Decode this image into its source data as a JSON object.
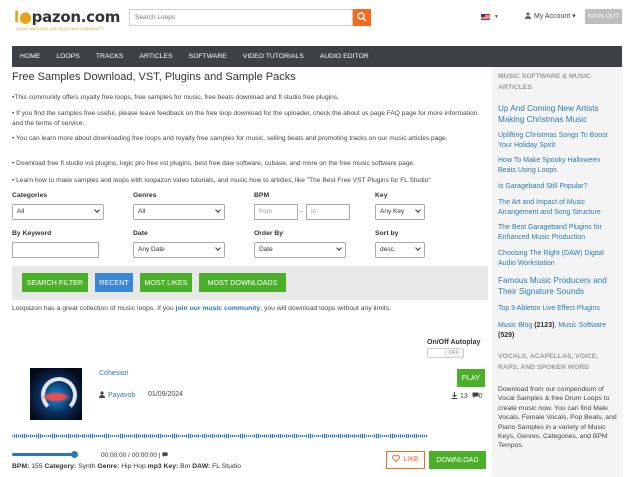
{
  "header": {
    "logo_text_prefix": "l",
    "logo_text_rest": "pazon.com",
    "logo_tagline": "AUDIO MATERIAL AND MUSICIAN COMMUNITY",
    "search_placeholder": "Search Loops",
    "account_label": "My Account",
    "signout_label": "SIGN OUT"
  },
  "nav": {
    "items": [
      "HOME",
      "LOOPS",
      "TRACKS",
      "ARTICLES",
      "SOFTWARE",
      "VIDEO TUTORIALS",
      "AUDIO EDITOR"
    ]
  },
  "main": {
    "title": "Free Samples Download, VST, Plugins and Sample Packs",
    "paragraphs": [
      "•This community offers royalty free loops, free samples for music, free beats download and fl studio free plugins.",
      "• If you find the samples free useful, please leave feedback on the free loop download for the uploader, check the about us page FAQ page for more information and the terms of service.",
      "• You can learn more about downloading free loops and royalty free samples for music, selling beats and promoting tracks on our music articles page.",
      "• Download free fl studio vst plugins, logic pro free vst plugins, best free daw software, cubase, and more on the free music software page.",
      "• Learn how to make samples and loops with loopazon video tutorials, and music how to articles, like \"The Best Free VST Plugins for FL Studio\""
    ]
  },
  "filters": {
    "categories_label": "Categories",
    "categories_value": "All",
    "genres_label": "Genres",
    "genres_value": "All",
    "bpm_label": "BPM",
    "bpm_from_placeholder": "from",
    "bpm_sep": "-",
    "bpm_to_placeholder": "to",
    "key_label": "Key",
    "key_value": "Any Key",
    "keyword_label": "By Keyword",
    "keyword_value": "",
    "date_label": "Date",
    "date_value": "Any Date",
    "orderby_label": "Order By",
    "orderby_value": "Date",
    "sortby_label": "Sort by",
    "sortby_value": "desc."
  },
  "filter_buttons": {
    "search_filter": "SEARCH FILTER",
    "recent": "RECENT",
    "most_likes": "MOST LIKES",
    "most_downloads": "MOST DOWNLOADS"
  },
  "community": {
    "before": "Loopazon has a great collection of music loops. If you ",
    "link": "join our music community",
    "after": ", you will download loops without any limits."
  },
  "autoplay": {
    "label": "On/Off Autoplay",
    "state": "OFF"
  },
  "track": {
    "title": "Cohesion",
    "user": "Payavob",
    "date": "01/09/2024",
    "play_label": "PLAY",
    "downloads": "13",
    "comments": "0",
    "time": "00:00:00 / 00:00:00 |",
    "bpm_label": "BPM:",
    "bpm": "155",
    "category_label": "Category:",
    "category": "Synth",
    "genre_label": "Genre:",
    "genre": "Hip Hop",
    "format": "mp3",
    "key_label": "Key:",
    "key": "Bm",
    "daw_label": "DAW:",
    "daw": "FL Studio",
    "like_label": "LIKE",
    "download_label": "DOWNLOAD"
  },
  "sidebar": {
    "heading1": "MUSIC SOFTWARE & MUSIC ARTICLES",
    "links": [
      "Up And Coming New Artists Making Christmas Music",
      "Uplifting Christmas Songs To Boost Your Holiday Spirit",
      "How To Make Spooky Halloween Beats Using Loops",
      "Is Garageband Still Popular?",
      "The Art and Impact of Music Arrangement and Song Structure",
      "The Best Garageband Plugins for Enhanced Music Production",
      "Choosing The Right (DAW) Digital Audio Workstation",
      "Famous Music Producers and Their Signature Sounds",
      "Top 9 Ableton Live Effect Plugins"
    ],
    "blog_label": "Music Blog",
    "blog_count": "(2123)",
    "software_label": "Music Software",
    "software_count": "(529)",
    "heading2": "VOCALS, ACAPELLAS, VOICE, RAPS, AND SPOKEN WORD",
    "vocals_text": "Download from our compendium of Vocal Samples & free Drum Loops to create music now. You can find Male Vocals, Female Vocals, Pop Beats, and Piano Samples in a variety of Music Keys, Genres, Categories, and BPM Tempos."
  },
  "colors": {
    "accent_orange": "#f36b1c",
    "green": "#4caf2a",
    "blue_button": "#3a86d8",
    "nav_bg": "#3d4145",
    "link_blue": "#2a7ab0"
  }
}
